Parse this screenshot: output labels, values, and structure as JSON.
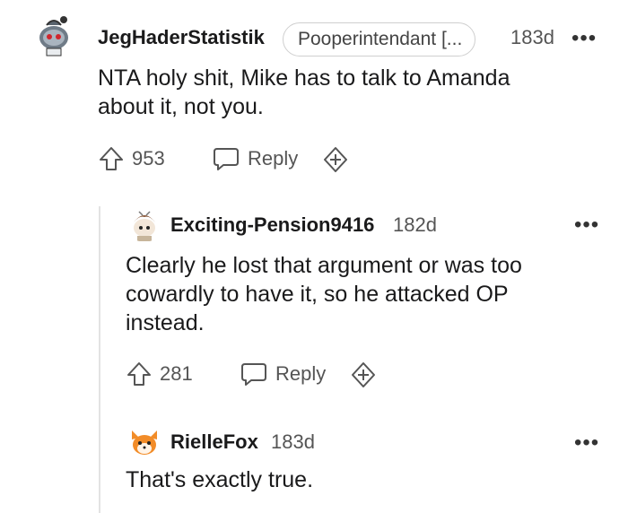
{
  "comments": [
    {
      "username": "JegHaderStatistik",
      "flair": "Pooperintendant [...",
      "age": "183d",
      "text_lines": [
        "NTA holy shit, Mike has to talk to Amanda",
        "about it, not you."
      ],
      "votes": "953",
      "reply_label": "Reply"
    },
    {
      "username": "Exciting-Pension9416",
      "age": "182d",
      "text_lines": [
        "Clearly he lost that argument or was too",
        "cowardly to have it, so he attacked OP",
        "instead."
      ],
      "votes": "281",
      "reply_label": "Reply"
    },
    {
      "username": "RielleFox",
      "age": "183d",
      "text_lines": [
        "That's exactly true."
      ]
    }
  ],
  "more_label": "•••"
}
